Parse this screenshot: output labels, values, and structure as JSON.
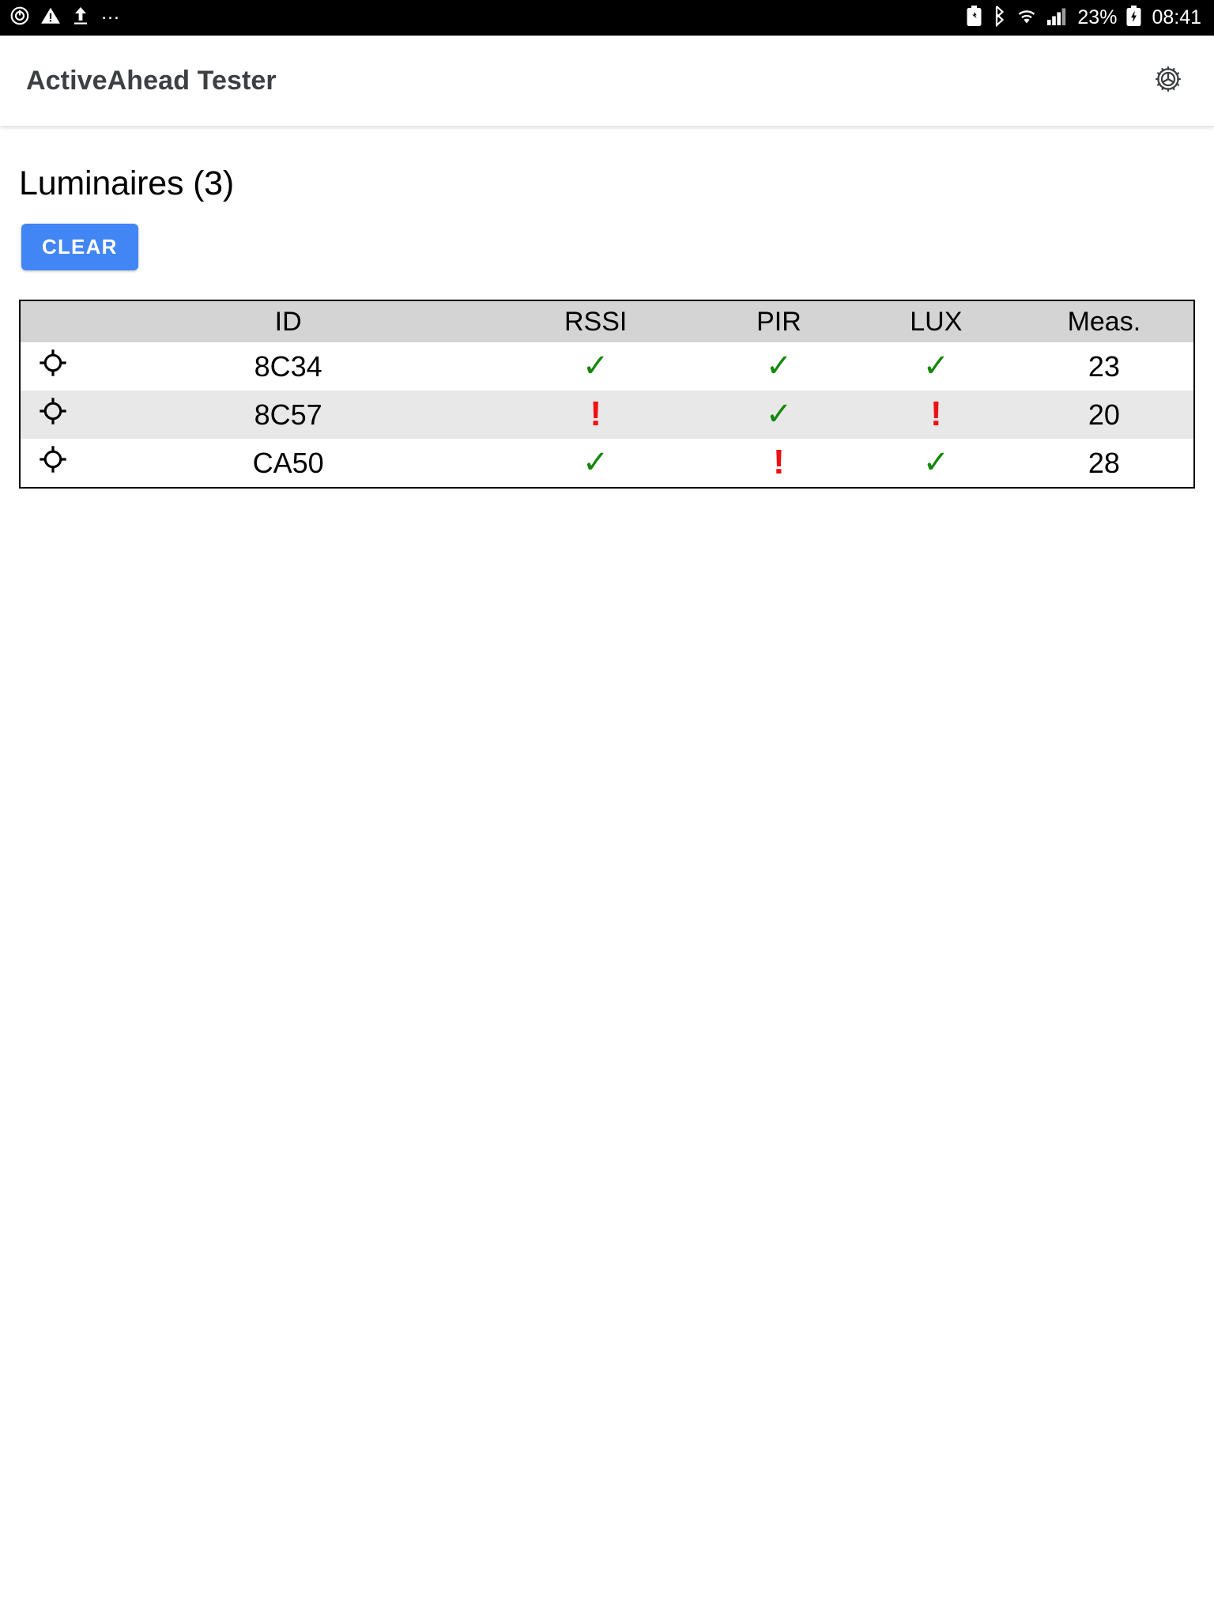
{
  "status_bar": {
    "left_icons": [
      "alarm-icon",
      "warning-icon",
      "upload-icon",
      "more-icon"
    ],
    "right_icons": [
      "battery-saver-icon",
      "bluetooth-icon",
      "wifi-icon",
      "cellular-signal-icon",
      "battery-charging-icon"
    ],
    "battery_percent": "23%",
    "time": "08:41"
  },
  "app_bar": {
    "title": "ActiveAhead Tester",
    "settings_icon": "gear-icon"
  },
  "main": {
    "page_title": "Luminaires (3)",
    "clear_label": "CLEAR",
    "table": {
      "columns": [
        "",
        "ID",
        "RSSI",
        "PIR",
        "LUX",
        "Meas."
      ],
      "rows": [
        {
          "icon": "crosshair-location-icon",
          "id": "8C34",
          "rssi": "ok",
          "pir": "ok",
          "lux": "ok",
          "meas": "23"
        },
        {
          "icon": "crosshair-location-icon",
          "id": "8C57",
          "rssi": "warn",
          "pir": "ok",
          "lux": "warn",
          "meas": "20"
        },
        {
          "icon": "crosshair-location-icon",
          "id": "CA50",
          "rssi": "ok",
          "pir": "warn",
          "lux": "ok",
          "meas": "28"
        }
      ],
      "marks": {
        "ok": "✓",
        "warn": "!"
      }
    }
  },
  "colors": {
    "accent": "#4285f4",
    "ok": "#138808",
    "warn": "#ee1111",
    "header_bg": "#d4d4d4",
    "row_alt_bg": "#e8e8e8",
    "title": "#3c4043"
  }
}
